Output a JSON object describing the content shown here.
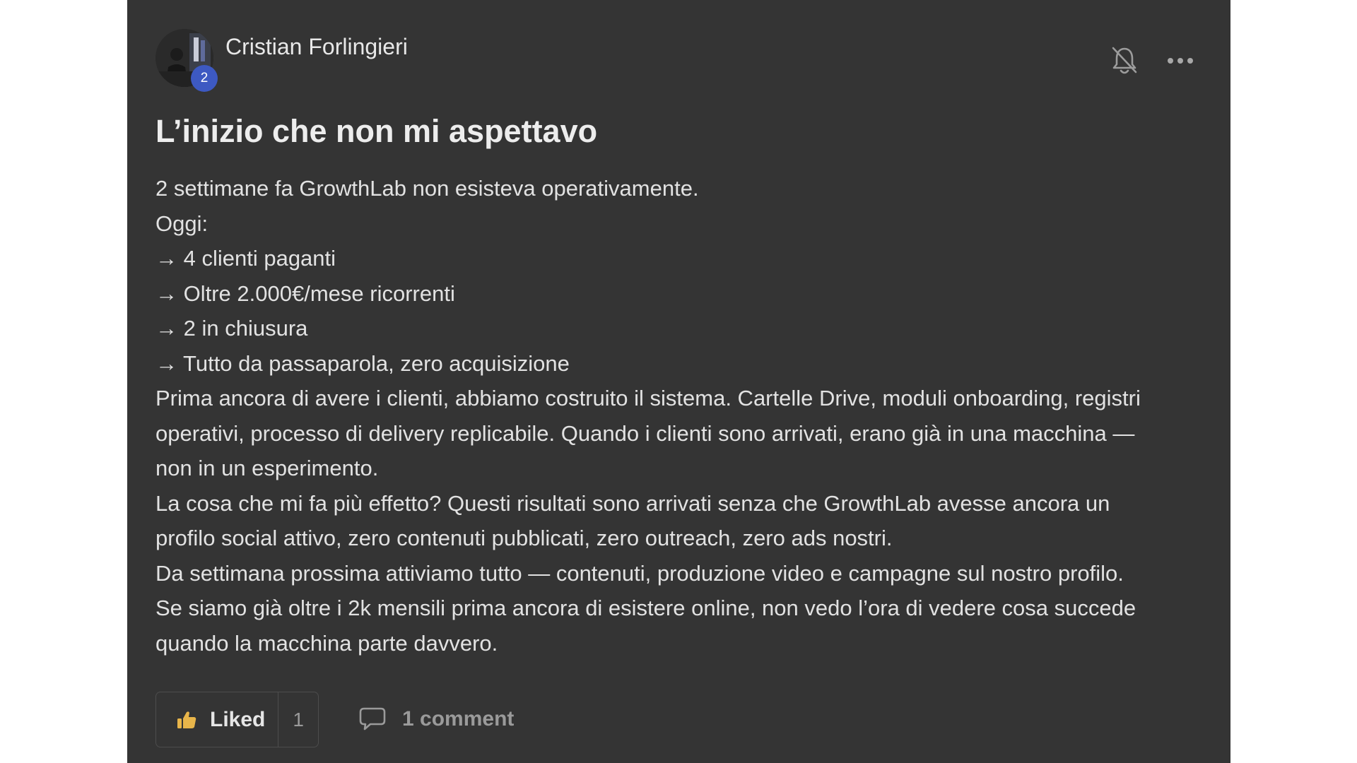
{
  "post": {
    "author": {
      "name": "Cristian Forlingieri",
      "level": "2"
    },
    "title": "L’inizio che non mi aspettavo",
    "body_lines": [
      "2 settimane fa GrowthLab non esisteva operativamente.",
      "Oggi:",
      "→ 4 clienti paganti",
      "→ Oltre 2.000€/mese ricorrenti",
      "→ 2 in chiusura",
      "→ Tutto da passaparola, zero acquisizione",
      "Prima ancora di avere i clienti, abbiamo costruito il sistema. Cartelle Drive, moduli onboarding, registri",
      "operativi, processo di delivery replicabile. Quando i clienti sono arrivati, erano già in una macchina —",
      "non in un esperimento.",
      "La cosa che mi fa più effetto? Questi risultati sono arrivati senza che GrowthLab avesse ancora un",
      "profilo social attivo, zero contenuti pubblicati, zero outreach, zero ads nostri.",
      "Da settimana prossima attiviamo tutto — contenuti, produzione video e campagne sul nostro profilo.",
      "Se siamo già oltre i 2k mensili prima ancora di esistere online, non vedo l’ora di vedere cosa succede",
      "quando la macchina parte davvero."
    ],
    "actions": {
      "like_label": "Liked",
      "like_count": "1",
      "comment_label": "1 comment"
    }
  },
  "icons": {
    "notification": "bell-off-icon",
    "menu": "more-horizontal-icon",
    "like": "thumbs-up-icon",
    "comment": "speech-bubble-icon"
  },
  "colors": {
    "card_background": "#343434",
    "page_background": "#ffffff",
    "level_badge": "#3d59c2",
    "like_icon": "#e8b54a",
    "text_primary": "#e2e2e2",
    "text_muted": "#9a9a9a"
  }
}
